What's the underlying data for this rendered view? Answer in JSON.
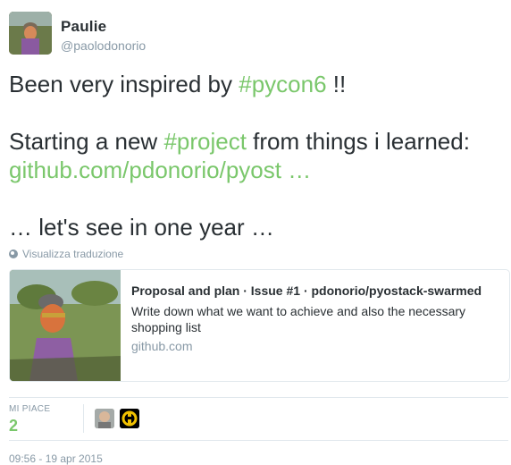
{
  "author": {
    "name": "Paulie",
    "handle": "@paolodonorio"
  },
  "tweet": {
    "line1_pre": "Been very inspired by ",
    "line1_tag": "#pycon6",
    "line1_post": " !!",
    "line2_pre": "Starting a new ",
    "line2_tag": "#project",
    "line2_post": " from things i learned:",
    "line3_link": " github.com/pdonorio/pyost …",
    "line4": "… let's see in one year …",
    "translate_label": "Visualizza traduzione"
  },
  "card": {
    "title": "Proposal and plan · Issue #1 · pdonorio/pyostack-swarmed",
    "description": "Write down what we want to achieve and also the necessary shopping list",
    "domain": "github.com"
  },
  "stats": {
    "likes_label": "MI PIACE",
    "likes_count": "2"
  },
  "timestamp": "09:56 - 19 apr 2015",
  "colors": {
    "link": "#7ac76b",
    "secondary_text": "#8899a6",
    "primary_text": "#292f33",
    "border": "#e1e8ed"
  },
  "icons": {
    "translate": "globe-icon"
  }
}
